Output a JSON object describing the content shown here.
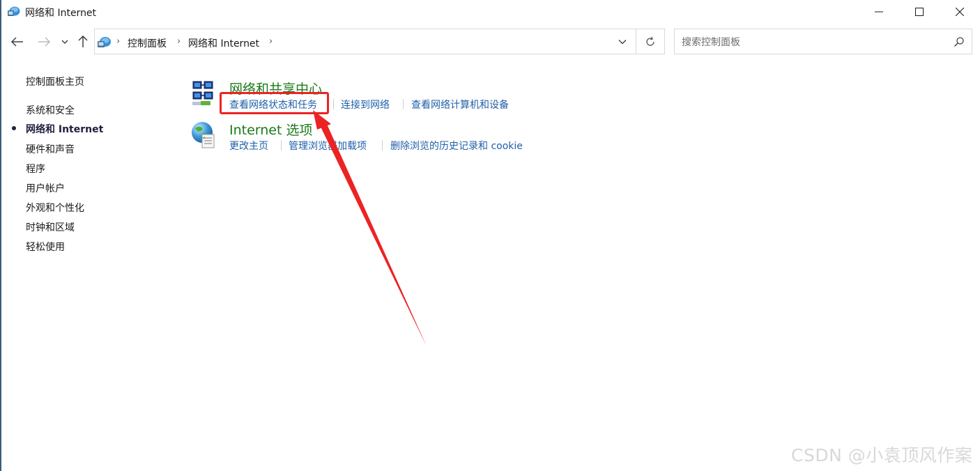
{
  "window": {
    "title": "网络和 Internet",
    "icon": "network-folder-icon"
  },
  "nav": {
    "back_icon": "arrow-left-icon",
    "forward_icon": "arrow-right-icon",
    "recent_icon": "chevron-down-icon",
    "up_icon": "arrow-up-icon"
  },
  "address": {
    "breadcrumbs": [
      "控制面板",
      "网络和 Internet"
    ],
    "separator": "›"
  },
  "search": {
    "placeholder": "搜索控制面板"
  },
  "sidebar": {
    "home": "控制面板主页",
    "items": [
      {
        "label": "系统和安全",
        "active": false
      },
      {
        "label": "网络和 Internet",
        "active": true
      },
      {
        "label": "硬件和声音",
        "active": false
      },
      {
        "label": "程序",
        "active": false
      },
      {
        "label": "用户帐户",
        "active": false
      },
      {
        "label": "外观和个性化",
        "active": false
      },
      {
        "label": "时钟和区域",
        "active": false
      },
      {
        "label": "轻松使用",
        "active": false
      }
    ]
  },
  "categories": [
    {
      "title": "网络和共享中心",
      "icon": "network-sharing-center-icon",
      "links": [
        "查看网络状态和任务",
        "连接到网络",
        "查看网络计算机和设备"
      ]
    },
    {
      "title": "Internet 选项",
      "icon": "internet-options-globe-icon",
      "links": [
        "更改主页",
        "管理浏览器加载项",
        "删除浏览的历史记录和 cookie"
      ]
    }
  ],
  "annotation": {
    "color": "#ec2323"
  },
  "watermark": "CSDN @小袁顶风作案",
  "colors": {
    "category_title": "#1a7a1a",
    "link": "#1f5fa8",
    "annotation": "#ec2323"
  }
}
